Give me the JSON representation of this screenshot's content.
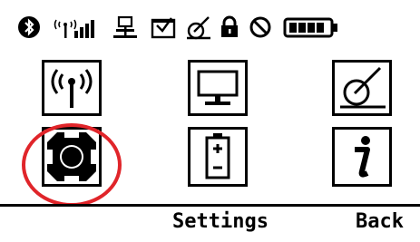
{
  "status_bar": {
    "icons": [
      "bluetooth-icon",
      "signal-icon",
      "network-icon",
      "inbox-icon",
      "connection-icon",
      "lock-icon",
      "blocked-icon",
      "battery-icon"
    ]
  },
  "menu": {
    "items": [
      {
        "icon": "wireless-icon"
      },
      {
        "icon": "display-icon"
      },
      {
        "icon": "connection-icon"
      },
      {
        "icon": "settings-gear-icon",
        "selected": true
      },
      {
        "icon": "battery-icon"
      },
      {
        "icon": "info-icon"
      }
    ]
  },
  "softkeys": {
    "center": "Settings",
    "right": "Back"
  },
  "colors": {
    "highlight": "#e0252a",
    "foreground": "#000000",
    "background": "#ffffff"
  }
}
